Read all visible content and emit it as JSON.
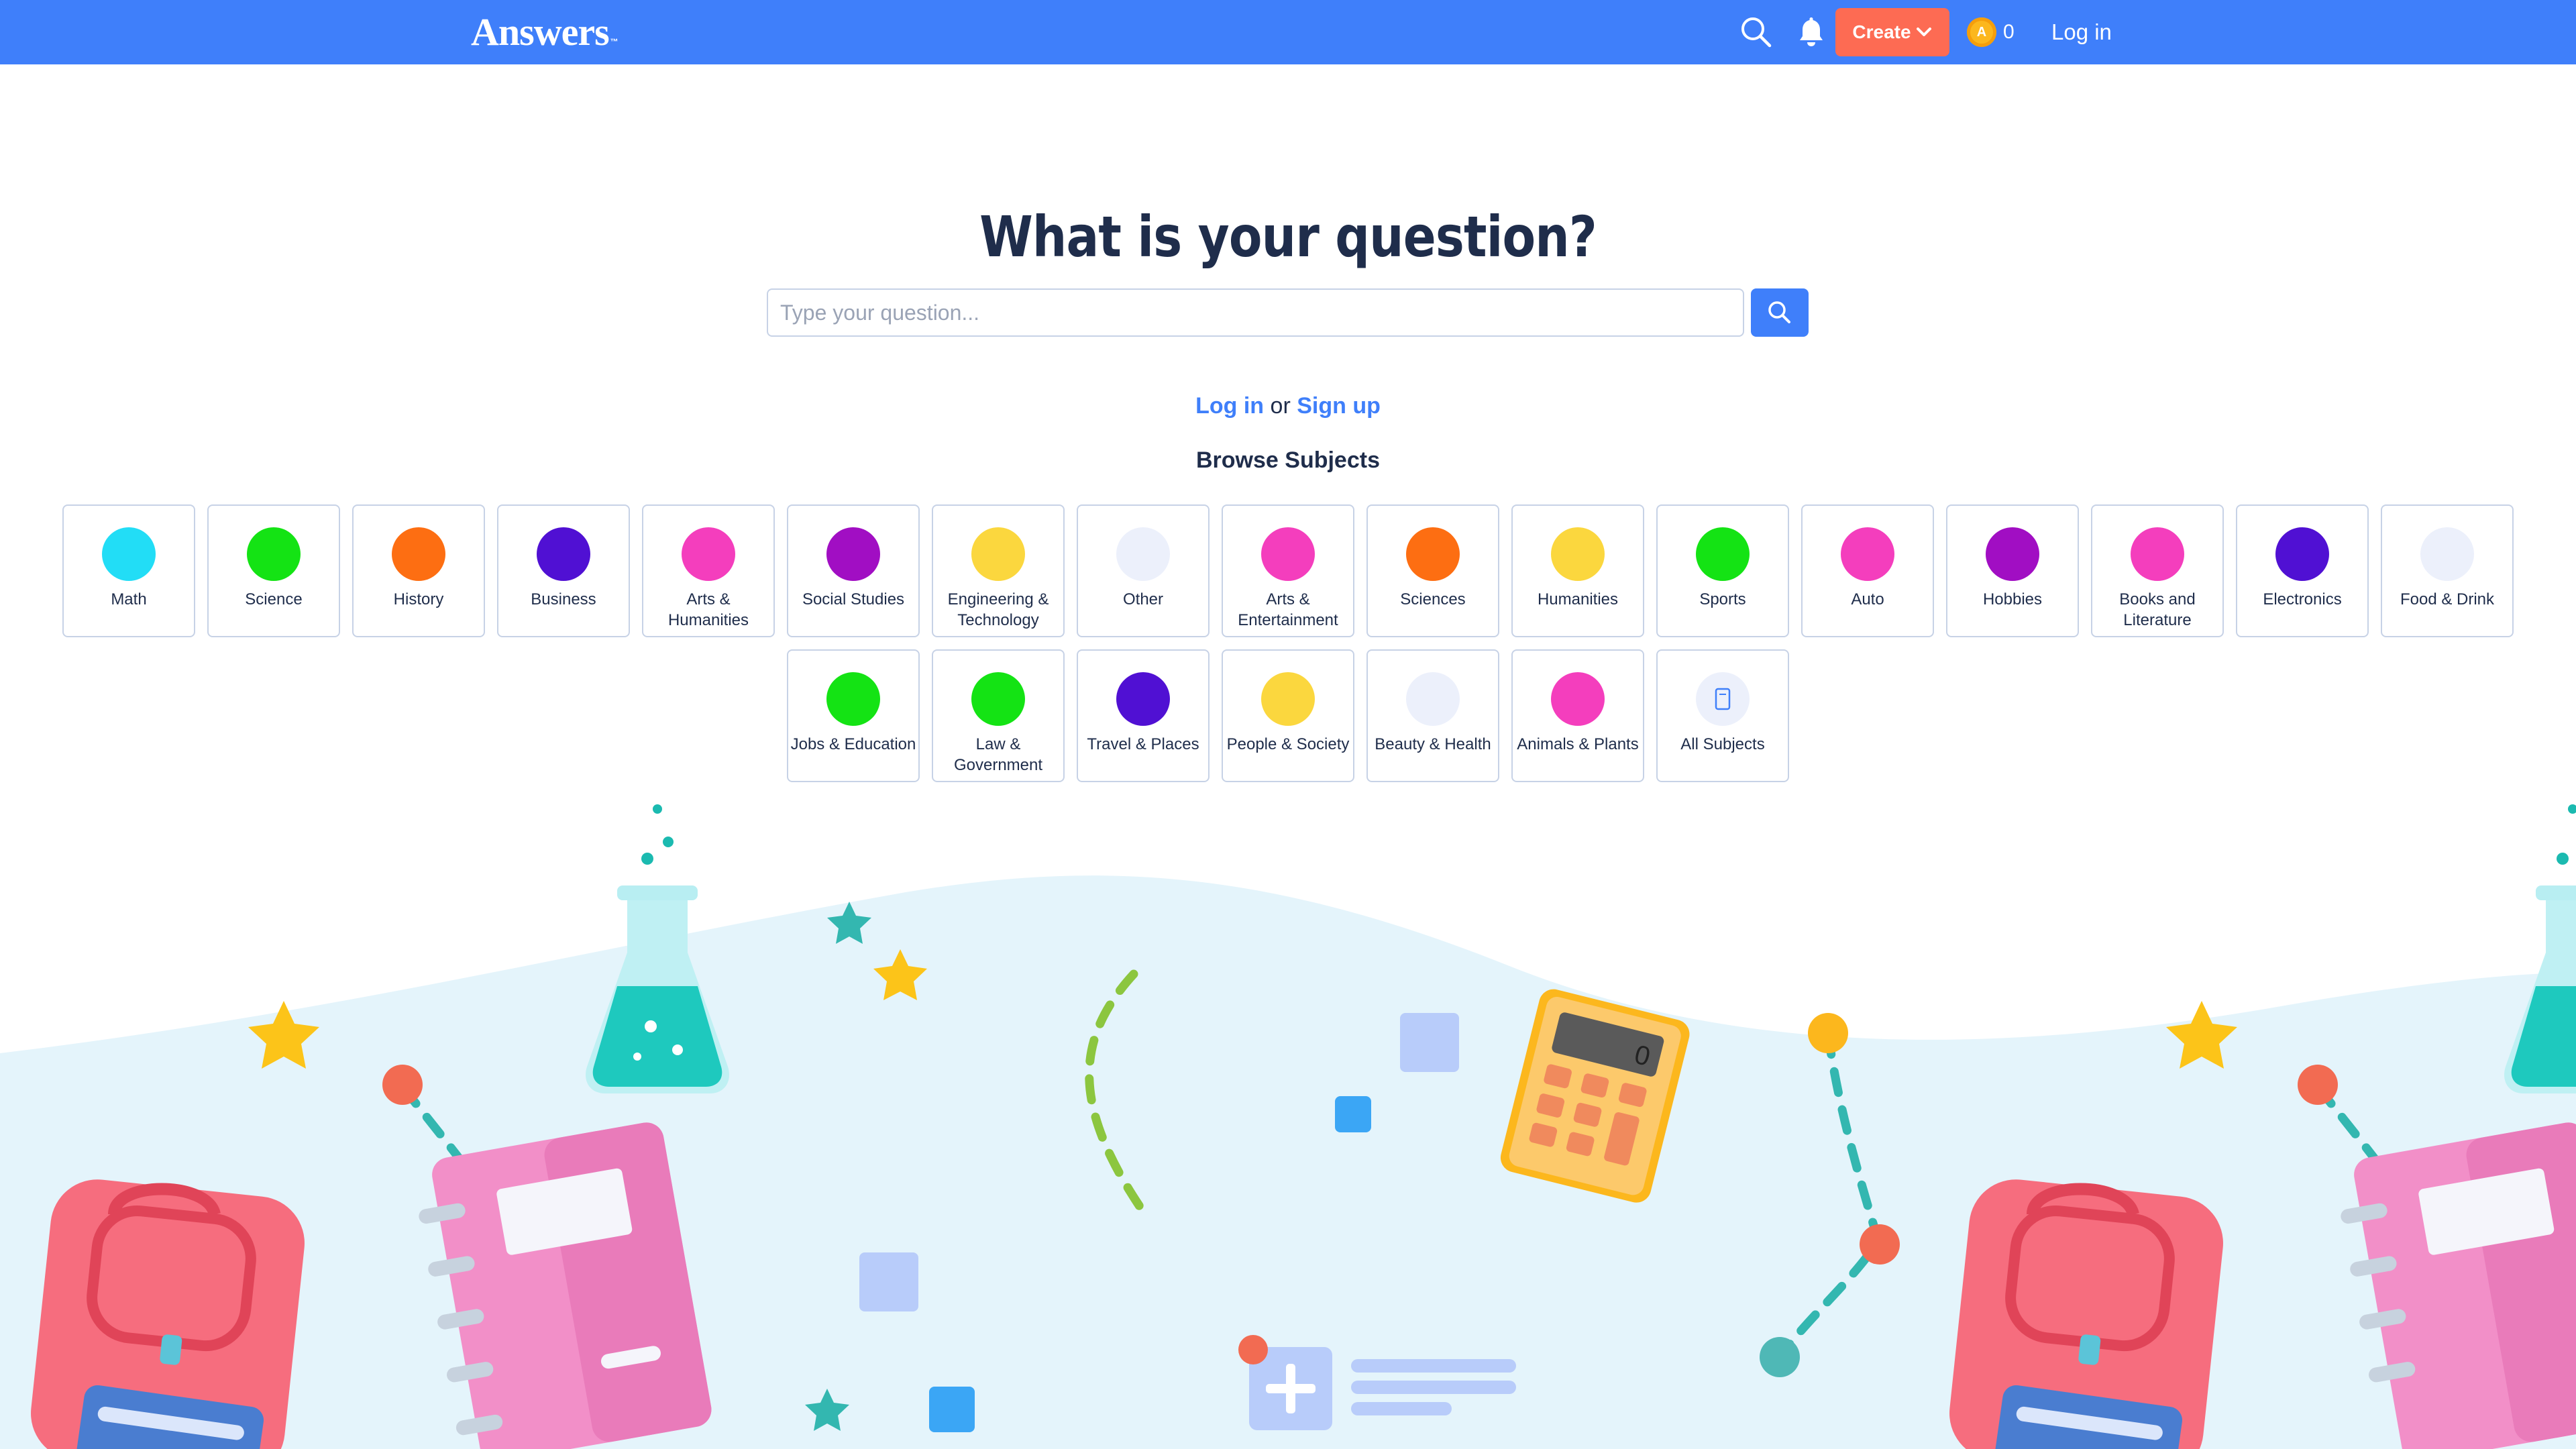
{
  "header": {
    "logo_text": "Answers",
    "logo_tm": "™",
    "create_label": "Create",
    "coin_symbol": "A",
    "coin_count": "0",
    "login_label": "Log in",
    "bg_color": "#3f7ffa",
    "create_color": "#fd6b53"
  },
  "main": {
    "title": "What is your question?",
    "search_placeholder": "Type your question...",
    "login_link": "Log in",
    "or_text": "or",
    "signup_link": "Sign up",
    "browse_title": "Browse Subjects"
  },
  "subjects": [
    {
      "label": "Math",
      "color": "#22ddf6"
    },
    {
      "label": "Science",
      "color": "#14e314"
    },
    {
      "label": "History",
      "color": "#fd6e12"
    },
    {
      "label": "Business",
      "color": "#5010d3"
    },
    {
      "label": "Arts & Humanities",
      "color": "#f43ebd"
    },
    {
      "label": "Social Studies",
      "color": "#a10ec3"
    },
    {
      "label": "Engineering & Technology",
      "color": "#fbd73e"
    },
    {
      "label": "Other",
      "color": "#ecf0fb"
    },
    {
      "label": "Arts & Entertainment",
      "color": "#f43ebd"
    },
    {
      "label": "Sciences",
      "color": "#fd6e12"
    },
    {
      "label": "Humanities",
      "color": "#fbd73e"
    },
    {
      "label": "Sports",
      "color": "#14e314"
    },
    {
      "label": "Auto",
      "color": "#f43ebd"
    },
    {
      "label": "Hobbies",
      "color": "#a10ec3"
    },
    {
      "label": "Books and Literature",
      "color": "#f43ebd"
    },
    {
      "label": "Electronics",
      "color": "#5010d3"
    },
    {
      "label": "Food & Drink",
      "color": "#ecf0fb"
    },
    {
      "label": "Jobs & Education",
      "color": "#14e314"
    },
    {
      "label": "Law & Government",
      "color": "#14e314"
    },
    {
      "label": "Travel & Places",
      "color": "#5010d3"
    },
    {
      "label": "People & Society",
      "color": "#fbd73e"
    },
    {
      "label": "Beauty & Health",
      "color": "#ecf0fb"
    },
    {
      "label": "Animals & Plants",
      "color": "#f43ebd"
    },
    {
      "label": "All Subjects",
      "color": "#ecf0fb",
      "icon": "grid-icon"
    }
  ]
}
